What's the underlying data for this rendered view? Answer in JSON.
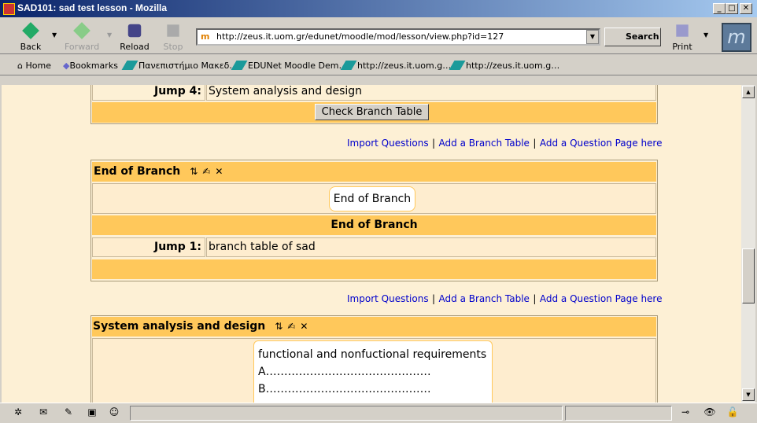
{
  "window": {
    "title": "SAD101: sad test lesson - Mozilla",
    "minimize": "_",
    "maximize": "□",
    "close": "✕"
  },
  "nav": {
    "back": "Back",
    "forward": "Forward",
    "reload": "Reload",
    "stop": "Stop",
    "print": "Print",
    "search": "Search",
    "url": "http://zeus.it.uom.gr/edunet/moodle/mod/lesson/view.php?id=127"
  },
  "bookmarks": {
    "home": "Home",
    "bookmarks": "Bookmarks",
    "items": [
      "Πανεπιστήμιο Μακεδ…",
      "EDUNet Moodle Dem…",
      "http://zeus.it.uom.g…",
      "http://zeus.it.uom.g…"
    ]
  },
  "content": {
    "jump4_label": "Jump 4:",
    "jump4_value": "System analysis and design",
    "check_button": "Check Branch Table",
    "links": {
      "import": "Import Questions",
      "sep": "|",
      "branch": "Add a Branch Table",
      "question": "Add a Question Page here"
    },
    "end_branch": {
      "title": "End of Branch",
      "contents": "End of Branch",
      "subtitle": "End of Branch",
      "jump1_label": "Jump 1:",
      "jump1_value": "branch table of sad"
    },
    "sad": {
      "title": "System analysis and design",
      "lines": [
        "functional and nonfuctional requirements",
        "A………………………………………",
        "B………………………………………"
      ]
    }
  },
  "colors": {
    "header": "#ffc85b",
    "background": "#fdf0d5",
    "link": "#0000cc"
  }
}
